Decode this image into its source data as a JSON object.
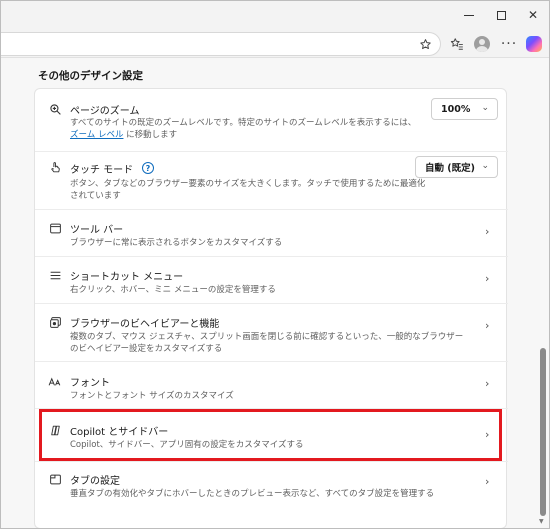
{
  "window": {
    "minimize": "—",
    "maximize": "□",
    "close": "✕"
  },
  "toolbar": {
    "address_value": "",
    "icons": [
      "star-icon",
      "favorites-icon",
      "profile-icon",
      "more-icon",
      "copilot-icon"
    ],
    "more_label": "···"
  },
  "section": {
    "title": "その他のデザイン設定"
  },
  "rows": [
    {
      "icon": "zoom-icon",
      "title": "ページのズーム",
      "desc_pre": "すべてのサイトの既定のズームレベルです。特定のサイトのズームレベルを表示するには、",
      "desc_link": "ズーム レベル",
      "desc_post": " に移動します",
      "select": "100%"
    },
    {
      "icon": "touch-icon",
      "title": "タッチ モード",
      "help": "?",
      "desc": "ボタン、タブなどのブラウザー要素のサイズを大きくします。タッチで使用するために最適化されています",
      "select": "自動 (既定)"
    },
    {
      "icon": "toolbar-icon",
      "title": "ツール バー",
      "desc": "ブラウザーに常に表示されるボタンをカスタマイズする"
    },
    {
      "icon": "menu-icon",
      "title": "ショートカット メニュー",
      "desc": "右クリック、ホバー、ミニ メニューの設定を管理する"
    },
    {
      "icon": "behavior-icon",
      "title": "ブラウザーのビヘイビアーと機能",
      "desc": "複数のタブ、マウス ジェスチャ、スプリット画面を閉じる前に確認するといった、一般的なブラウザーのビヘイビアー設定をカスタマイズする"
    },
    {
      "icon": "font-icon",
      "title": "フォント",
      "desc": "フォントとフォント サイズのカスタマイズ"
    },
    {
      "icon": "copilot-sidebar-icon",
      "title": "Copilot とサイドバー",
      "desc": "Copilot、サイドバー、アプリ固有の設定をカスタマイズする"
    },
    {
      "icon": "tabs-icon",
      "title": "タブの設定",
      "desc": "垂直タブの有効化やタブにホバーしたときのプレビュー表示など、すべてのタブ設定を管理する"
    }
  ],
  "colors": {
    "accent": "#0f6cbd",
    "highlight": "#e3191f"
  }
}
